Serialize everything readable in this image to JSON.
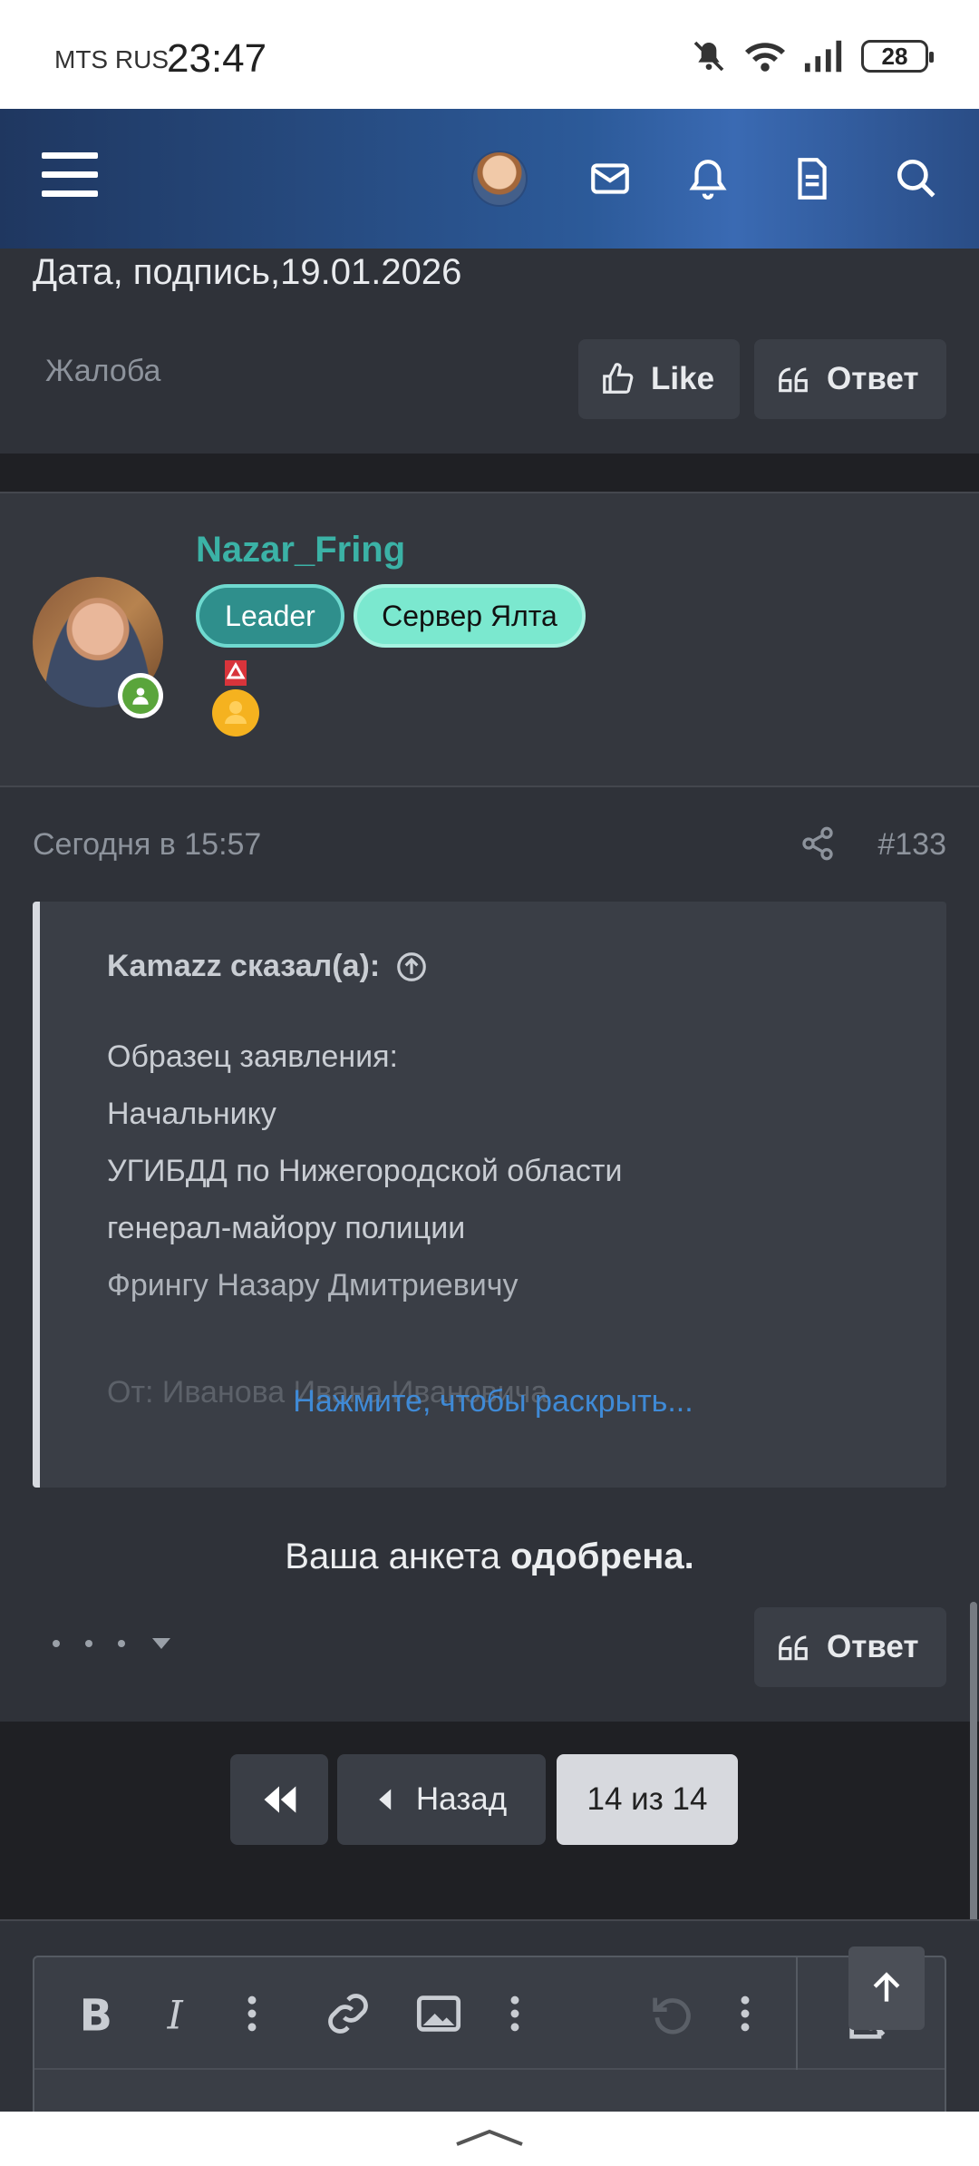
{
  "status_bar": {
    "carrier": "MTS RUS",
    "time": "23:47",
    "battery": "28"
  },
  "header": {
    "icons": [
      "menu-icon",
      "avatar",
      "envelope-icon",
      "bell-icon",
      "document-icon",
      "search-icon"
    ]
  },
  "previous_post": {
    "text": "Дата, подпись,19.01.2026",
    "report_label": "Жалоба",
    "like_label": "Like",
    "reply_label": "Ответ"
  },
  "user": {
    "name": "Nazar_Fring",
    "badges": [
      "Leader",
      "Сервер Ялта"
    ],
    "online": true
  },
  "post": {
    "time": "Сегодня в 15:57",
    "number": "#133",
    "quote": {
      "author": "Kamazz сказал(а):",
      "lines": [
        "Образец заявления:",
        "Начальнику",
        "УГИБДД по Нижегородской области",
        "генерал-майору полиции",
        "Фрингу Назару Дмитриевичу"
      ],
      "faded_line": "От: Иванова Ивана Ивановича",
      "expand_label": "Нажмите, чтобы раскрыть..."
    },
    "text_prefix": "Ваша анкета ",
    "text_bold": "одобрена.",
    "reply_label": "Ответ"
  },
  "pagination": {
    "back_label": "Назад",
    "current": "14 из 14"
  },
  "editor": {
    "tools": [
      "bold-icon",
      "italic-icon",
      "more-icon",
      "link-icon",
      "image-icon",
      "more-icon",
      "undo-icon",
      "more-icon",
      "preview-icon"
    ]
  },
  "colors": {
    "accent": "#3bb2a6",
    "link": "#3f8ad6",
    "header_blue": "#2c5a99",
    "online_green": "#5aa53b"
  }
}
